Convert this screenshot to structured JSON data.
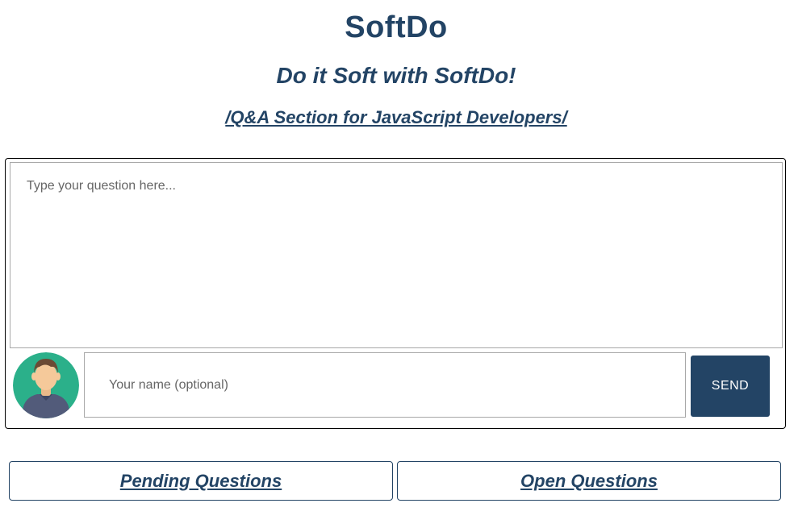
{
  "header": {
    "title": "SoftDo",
    "tagline": "Do it Soft with SoftDo!",
    "section_link": "/Q&A Section for JavaScript Developers/"
  },
  "composer": {
    "question_placeholder": "Type your question here...",
    "question_value": "",
    "name_placeholder": "Your name (optional)",
    "name_value": "",
    "send_label": "SEND",
    "avatar_icon": "user-avatar-icon"
  },
  "tabs": {
    "pending_label": "Pending Questions",
    "open_label": "Open Questions"
  },
  "colors": {
    "brand": "#234465",
    "avatar_bg": "#2bb08a",
    "avatar_skin": "#f5c99a",
    "avatar_hair": "#6b4a34",
    "avatar_shirt": "#525b7a"
  }
}
